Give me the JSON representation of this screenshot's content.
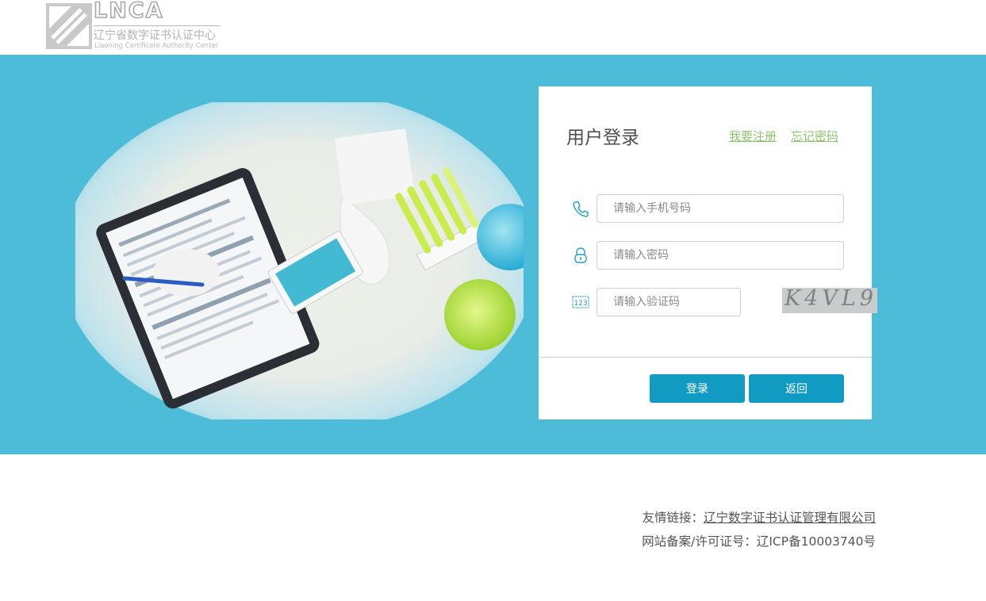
{
  "header": {
    "logo_letters": "LNCA",
    "logo_cn": "辽宁省数字证书认证中心",
    "logo_en": "Liaoning Certificate Authority Center"
  },
  "login": {
    "title": "用户登录",
    "register_link": "我要注册",
    "forgot_link": "忘记密码",
    "phone_placeholder": "请输入手机号码",
    "password_placeholder": "请输入密码",
    "captcha_placeholder": "请输入验证码",
    "captcha_text": "K4VL9",
    "login_button": "登录",
    "back_button": "返回"
  },
  "footer": {
    "links_label": "友情链接：",
    "link_text": "辽宁数字证书认证管理有限公司",
    "icp": "网站备案/许可证号：辽ICP备10003740号"
  },
  "colors": {
    "banner": "#4dbcd9",
    "button": "#129bc2",
    "link": "#8dc66a"
  }
}
